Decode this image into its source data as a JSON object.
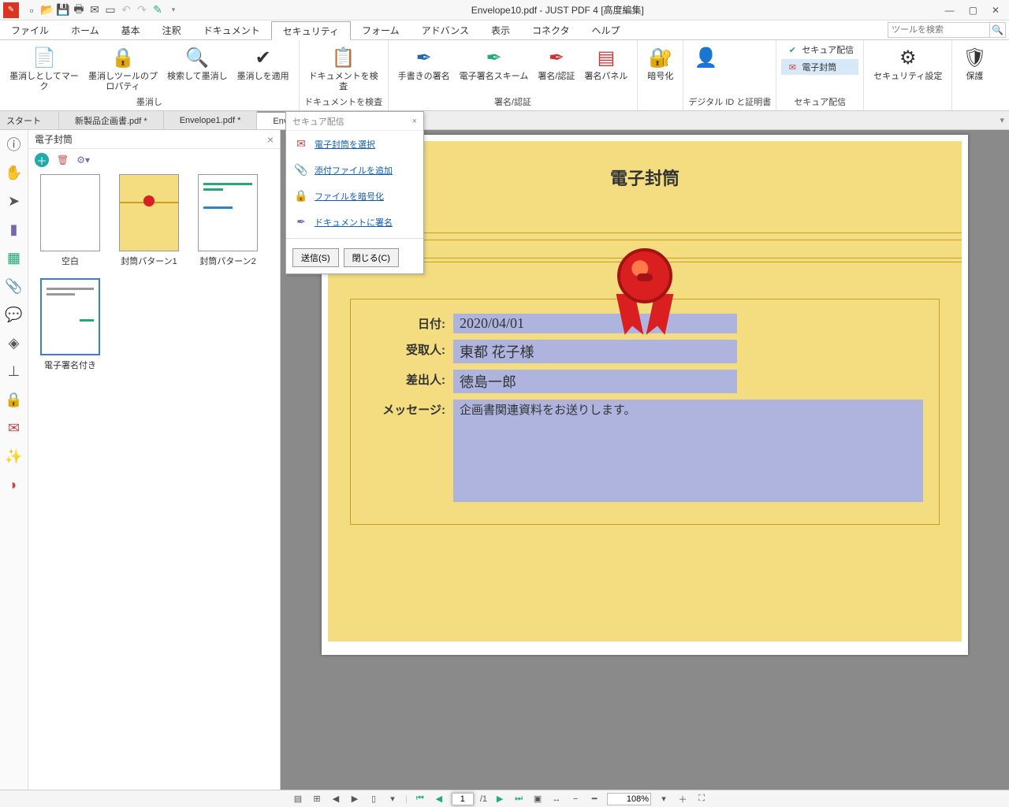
{
  "app": {
    "title": "Envelope10.pdf - JUST PDF 4 [高度編集]"
  },
  "menu": {
    "file": "ファイル",
    "home": "ホーム",
    "basic": "基本",
    "annot": "注釈",
    "document": "ドキュメント",
    "security": "セキュリティ",
    "form": "フォーム",
    "advanced": "アドバンス",
    "view": "表示",
    "connector": "コネクタ",
    "help": "ヘルプ",
    "search_placeholder": "ツールを検索"
  },
  "ribbon": {
    "groups": {
      "redact": {
        "label": "墨消し",
        "b1": "墨消しとしてマーク",
        "b2": "墨消しツールのプロパティ",
        "b3": "検索して墨消し",
        "b4": "墨消しを適用"
      },
      "check": {
        "label": "ドキュメントを検査",
        "b1": "ドキュメントを検査"
      },
      "sign": {
        "label": "署名/認証",
        "b1": "手書きの署名",
        "b2": "電子署名スキーム",
        "b3": "署名/認証",
        "b4": "署名パネル"
      },
      "encrypt": {
        "label": "",
        "b1": "暗号化"
      },
      "id": {
        "label": "デジタル ID と証明書"
      },
      "secure": {
        "label": "セキュア配信",
        "i1": "セキュア配信",
        "i2": "電子封筒"
      },
      "secset": {
        "label": "",
        "b1": "セキュリティ設定"
      },
      "protect": {
        "label": "",
        "b1": "保護"
      }
    }
  },
  "tabs": {
    "start": "スタート",
    "t1": "新製品企画書.pdf *",
    "t2": "Envelope1.pdf *",
    "t3": "Enve"
  },
  "panel": {
    "title": "電子封筒",
    "items": [
      "空白",
      "封筒パターン1",
      "封筒パターン2",
      "電子署名付き"
    ]
  },
  "popup": {
    "title": "セキュア配信",
    "links": [
      "電子封筒を選択",
      "添付ファイルを追加",
      "ファイルを暗号化",
      "ドキュメントに署名"
    ],
    "send": "送信(S)",
    "close": "閉じる(C)"
  },
  "envelope": {
    "title": "電子封筒",
    "labels": {
      "date": "日付:",
      "to": "受取人:",
      "from": "差出人:",
      "msg": "メッセージ:"
    },
    "values": {
      "date": "2020/04/01",
      "to": "東都 花子様",
      "from": "徳島一郎",
      "msg": "企画書関連資料をお送りします。"
    }
  },
  "status": {
    "page_current": "1",
    "page_total": "/1",
    "zoom": "108%"
  }
}
